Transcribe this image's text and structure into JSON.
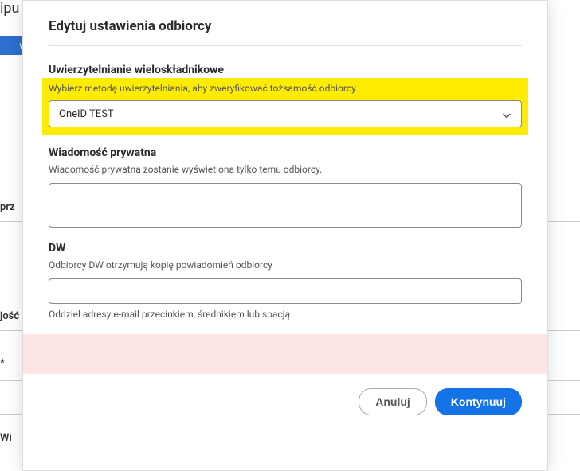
{
  "background": {
    "topText": "ipu",
    "blueBtn": "więc",
    "labelPrz": "prz",
    "labelJosc": "jość",
    "labelStar": "*",
    "labelWi": "Wi"
  },
  "modal": {
    "title": "Edytuj ustawienia odbiorcy",
    "mfa": {
      "heading": "Uwierzytelnianie wieloskładnikowe",
      "desc": "Wybierz metodę uwierzytelniania, aby zweryfikować tożsamość odbiorcy.",
      "selectedValue": "OneID TEST"
    },
    "privateMsg": {
      "heading": "Wiadomość prywatna",
      "desc": "Wiadomość prywatna zostanie wyświetlona tylko temu odbiorcy.",
      "value": ""
    },
    "cc": {
      "heading": "DW",
      "desc": "Odbiorcy DW otrzymują kopię powiadomień odbiorcy",
      "value": "",
      "help": "Oddziel adresy e-mail przecinkiem, średnikiem lub spacją"
    },
    "buttons": {
      "cancel": "Anuluj",
      "continue": "Kontynuuj"
    }
  }
}
